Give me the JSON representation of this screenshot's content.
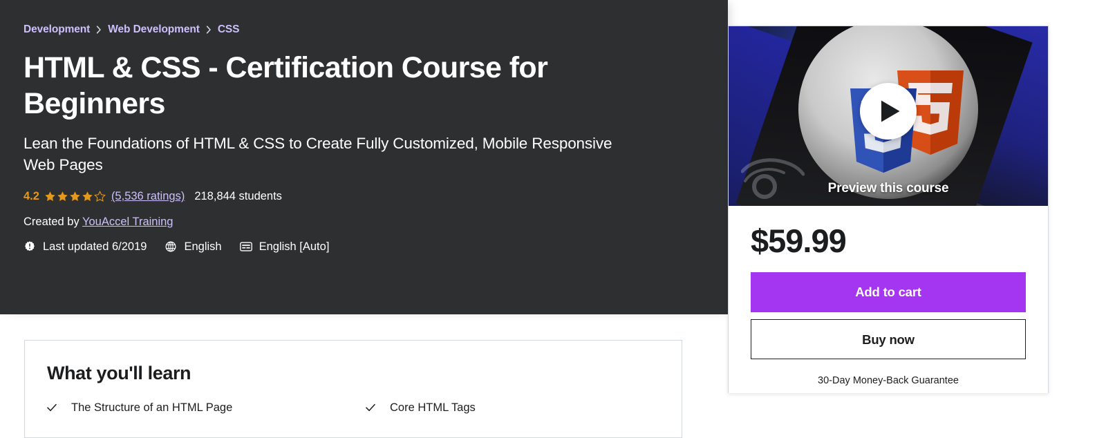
{
  "breadcrumb": {
    "items": [
      {
        "label": "Development"
      },
      {
        "label": "Web Development"
      },
      {
        "label": "CSS"
      }
    ],
    "separator": "›"
  },
  "hero": {
    "title": "HTML & CSS - Certification Course for Beginners",
    "headline": "Lean the Foundations of HTML & CSS to Create Fully Customized, Mobile Responsive Web Pages",
    "rating": {
      "score": "4.2",
      "stars_filled": 4,
      "stars_total": 5,
      "ratings_link": "(5,536 ratings)",
      "students": "218,844 students",
      "star_color": "#e59819"
    },
    "created_by_prefix": "Created by ",
    "instructor": "YouAccel Training",
    "meta": [
      {
        "icon": "update-badge-icon",
        "label": "Last updated 6/2019"
      },
      {
        "icon": "globe-icon",
        "label": "English"
      },
      {
        "icon": "closed-caption-icon",
        "label": "English [Auto]"
      }
    ],
    "background_color": "#2d2f31",
    "link_color": "#cec0fc"
  },
  "sidebar": {
    "preview": {
      "label": "Preview this course",
      "play_icon": "play-icon"
    },
    "price": "$59.99",
    "add_to_cart_label": "Add to cart",
    "buy_now_label": "Buy now",
    "guarantee": "30-Day Money-Back Guarantee",
    "accent_color": "#a435f0"
  },
  "what_you_will_learn": {
    "title": "What you'll learn",
    "items": [
      {
        "text": "The Structure of an HTML Page"
      },
      {
        "text": "Core HTML Tags"
      }
    ],
    "check_icon": "check-icon"
  }
}
